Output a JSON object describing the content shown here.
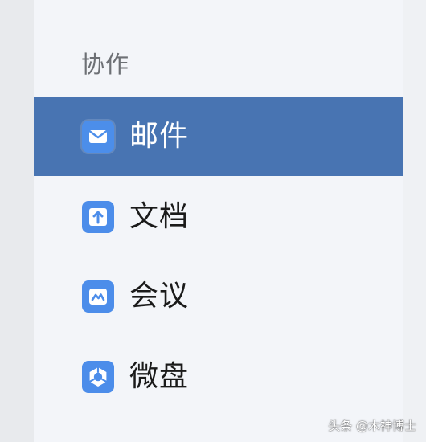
{
  "sidebar": {
    "section_title": "协作",
    "items": [
      {
        "label": "邮件",
        "icon": "mail-icon",
        "active": true
      },
      {
        "label": "文档",
        "icon": "document-icon",
        "active": false
      },
      {
        "label": "会议",
        "icon": "meeting-icon",
        "active": false
      },
      {
        "label": "微盘",
        "icon": "drive-icon",
        "active": false
      }
    ]
  },
  "watermark": "头条 @木神博士",
  "colors": {
    "active_bg": "#4874b2",
    "icon_blue": "#4c8dea",
    "panel_bg": "#f3f5f9"
  }
}
